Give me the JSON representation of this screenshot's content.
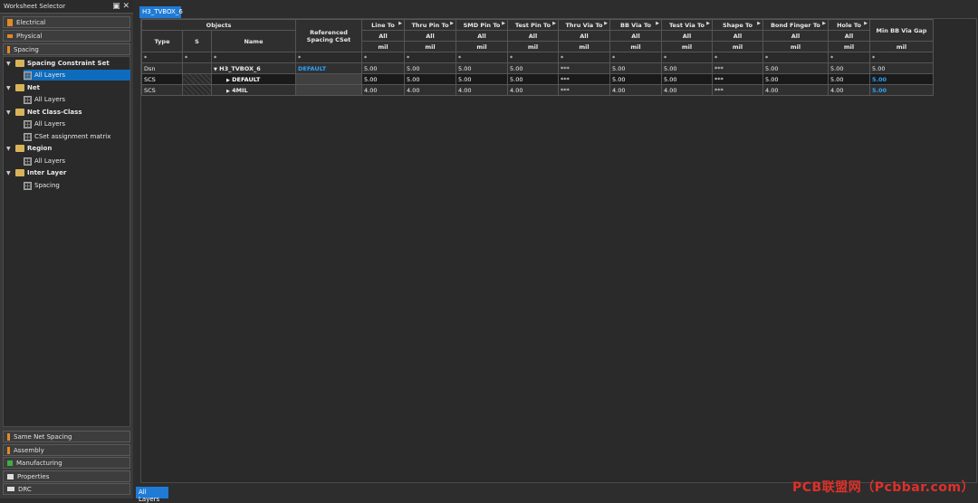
{
  "left_panel": {
    "title": "Worksheet Selector",
    "top_sections": [
      "Electrical",
      "Physical",
      "Spacing"
    ],
    "tree": [
      {
        "label": "Spacing Constraint Set",
        "level": 0,
        "type": "folder",
        "bold": true
      },
      {
        "label": "All Layers",
        "level": 1,
        "type": "grid",
        "selected": true
      },
      {
        "label": "Net",
        "level": 0,
        "type": "folder",
        "bold": true
      },
      {
        "label": "All Layers",
        "level": 1,
        "type": "grid"
      },
      {
        "label": "Net Class-Class",
        "level": 0,
        "type": "folder",
        "bold": true
      },
      {
        "label": "All Layers",
        "level": 1,
        "type": "grid"
      },
      {
        "label": "CSet assignment matrix",
        "level": 1,
        "type": "grid"
      },
      {
        "label": "Region",
        "level": 0,
        "type": "folder",
        "bold": true
      },
      {
        "label": "All Layers",
        "level": 1,
        "type": "grid"
      },
      {
        "label": "Inter Layer",
        "level": 0,
        "type": "folder",
        "bold": true
      },
      {
        "label": "Spacing",
        "level": 1,
        "type": "grid"
      }
    ],
    "bottom_sections": [
      "Same Net Spacing",
      "Assembly",
      "Manufacturing",
      "Properties",
      "DRC"
    ]
  },
  "tabs": {
    "top": "H3_TVBOX_6",
    "bottom": "All Layers"
  },
  "grid": {
    "objects_header": "Objects",
    "obj_cols": [
      "Type",
      "S",
      "Name"
    ],
    "ref_header": "Referenced Spacing CSet",
    "value_cols": [
      {
        "label": "Line To",
        "sub": "All",
        "unit": "mil"
      },
      {
        "label": "Thru Pin To",
        "sub": "All",
        "unit": "mil"
      },
      {
        "label": "SMD Pin To",
        "sub": "All",
        "unit": "mil"
      },
      {
        "label": "Test Pin To",
        "sub": "All",
        "unit": "mil"
      },
      {
        "label": "Thru Via To",
        "sub": "All",
        "unit": "mil"
      },
      {
        "label": "BB Via To",
        "sub": "All",
        "unit": "mil"
      },
      {
        "label": "Test Via To",
        "sub": "All",
        "unit": "mil"
      },
      {
        "label": "Shape To",
        "sub": "All",
        "unit": "mil"
      },
      {
        "label": "Bond Finger To",
        "sub": "All",
        "unit": "mil"
      },
      {
        "label": "Hole To",
        "sub": "All",
        "unit": "mil"
      }
    ],
    "last_col": {
      "label": "Min BB Via Gap",
      "unit": "mil"
    },
    "filter_symbol": "*",
    "rows": [
      {
        "type": "Dsn",
        "s": "",
        "name": "H3_TVBOX_6",
        "ref": "DEFAULT",
        "values": [
          "5.00",
          "5.00",
          "5.00",
          "5.00",
          "***",
          "5.00",
          "5.00",
          "***",
          "5.00",
          "5.00",
          "5.00"
        ]
      },
      {
        "type": "SCS",
        "s": "",
        "name": "DEFAULT",
        "ref": "",
        "values": [
          "5.00",
          "5.00",
          "5.00",
          "5.00",
          "***",
          "5.00",
          "5.00",
          "***",
          "5.00",
          "5.00",
          "5.00"
        ]
      },
      {
        "type": "SCS",
        "s": "",
        "name": "4MIL",
        "ref": "",
        "values": [
          "4.00",
          "4.00",
          "4.00",
          "4.00",
          "***",
          "4.00",
          "4.00",
          "***",
          "4.00",
          "4.00",
          "5.00"
        ]
      }
    ]
  },
  "watermark": "PCB联盟网（Pcbbar.com）",
  "colors": {
    "accent": "#1f7bd6",
    "highlight_text": "#29a3ff",
    "folder": "#d9b35a",
    "watermark": "#e0302a"
  }
}
